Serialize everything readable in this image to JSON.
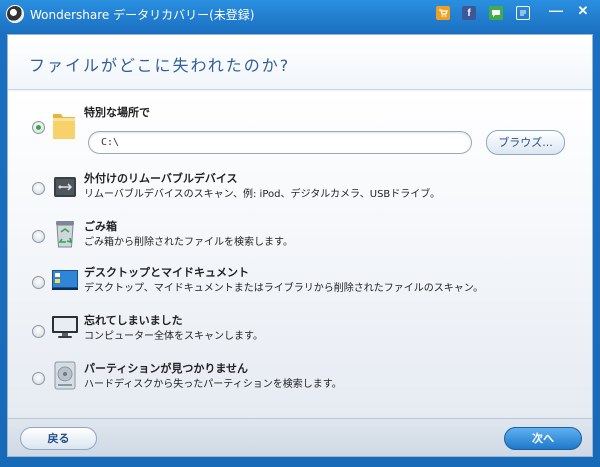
{
  "window": {
    "title": "Wondershare データリカバリー(未登録)",
    "toolbar": {
      "cart_icon": "cart-icon",
      "facebook_label": "f",
      "chat_icon": "chat-icon",
      "register_icon": "register-icon",
      "minimize_label": "—",
      "close_label": "✕"
    }
  },
  "header": {
    "title": "ファイルがどこに失われたのか?"
  },
  "options": [
    {
      "title": "特別な場所で",
      "desc": "",
      "icon": "folder-icon",
      "checked": true
    },
    {
      "title": "外付けのリムーバブルデバイス",
      "desc": "リムーバブルデバイスのスキャン、例: iPod、デジタルカメラ、USBドライブ。",
      "icon": "usb-drive-icon",
      "checked": false
    },
    {
      "title": "ごみ箱",
      "desc": "ごみ箱から削除されたファイルを検索します。",
      "icon": "recycle-bin-icon",
      "checked": false
    },
    {
      "title": "デスクトップとマイドキュメント",
      "desc": "デスクトップ、マイドキュメントまたはライブラリから削除されたファイルのスキャン。",
      "icon": "desktop-icon",
      "checked": false
    },
    {
      "title": "忘れてしまいました",
      "desc": "コンピューター全体をスキャンします。",
      "icon": "computer-icon",
      "checked": false
    },
    {
      "title": "パーティションが見つかりません",
      "desc": "ハードディスクから失ったパーティションを検索します。",
      "icon": "hard-disk-icon",
      "checked": false
    }
  ],
  "location": {
    "path": "C:\\",
    "browse_label": "ブラウズ..."
  },
  "footer": {
    "back_label": "戻る",
    "next_label": "次へ"
  },
  "colors": {
    "title_bar": "#1b6fc0",
    "header_text": "#2f5f9a",
    "next_button": "#1f78cc",
    "radio_checked": "#3aa93a"
  }
}
